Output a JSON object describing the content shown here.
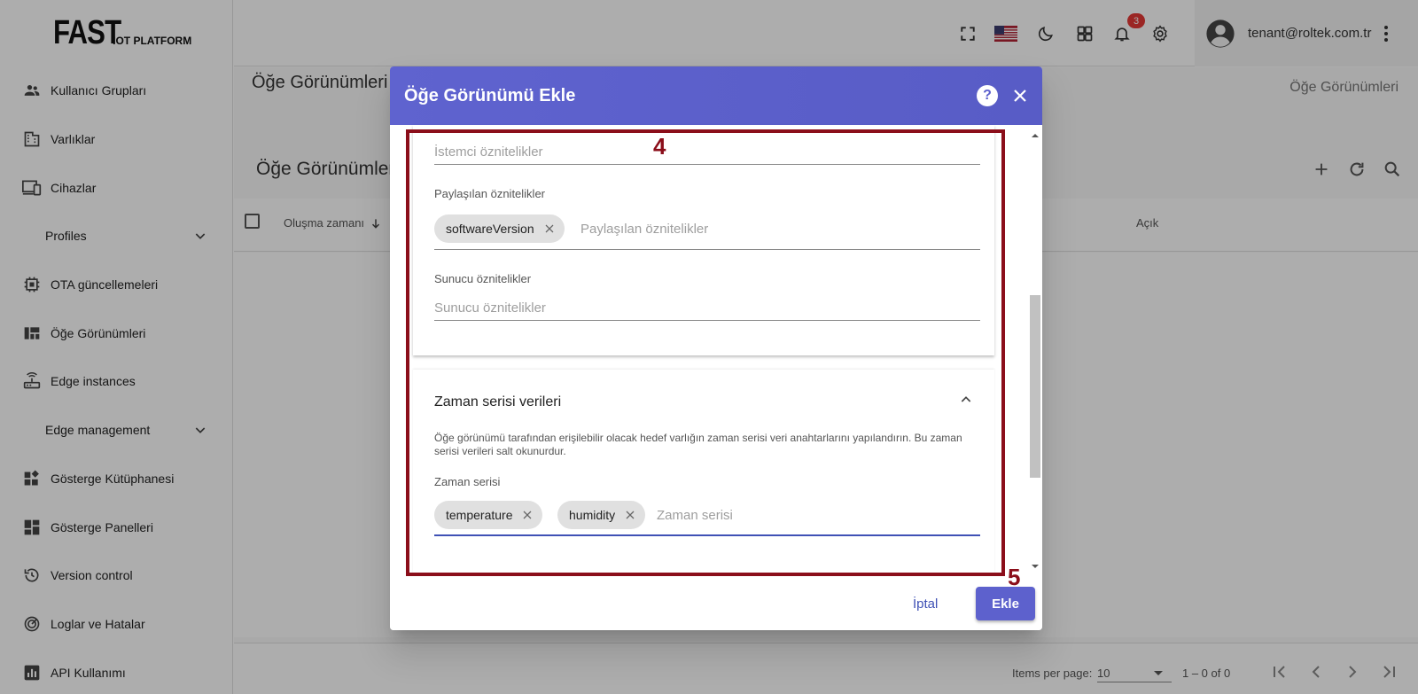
{
  "logo": {
    "main": "FAST",
    "sub": "IOT PLATFORM"
  },
  "sidebar": {
    "items": [
      {
        "label": "Kullanıcı Grupları",
        "icon": "users-icon"
      },
      {
        "label": "Varlıklar",
        "icon": "building-icon"
      },
      {
        "label": "Cihazlar",
        "icon": "devices-icon"
      },
      {
        "label": "Profiles",
        "icon": "",
        "section": true
      },
      {
        "label": "OTA güncellemeleri",
        "icon": "chip-icon"
      },
      {
        "label": "Öğe Görünümleri",
        "icon": "view-quilt-icon"
      },
      {
        "label": "Edge instances",
        "icon": "router-icon"
      },
      {
        "label": "Edge management",
        "icon": "",
        "section": true
      },
      {
        "label": "Gösterge Kütüphanesi",
        "icon": "widgets-icon"
      },
      {
        "label": "Gösterge Panelleri",
        "icon": "dashboard-icon"
      },
      {
        "label": "Version control",
        "icon": "history-icon"
      },
      {
        "label": "Loglar ve Hatalar",
        "icon": "track-changes-icon"
      },
      {
        "label": "API Kullanımı",
        "icon": "bar-chart-icon"
      }
    ]
  },
  "header": {
    "notification_count": "3",
    "user_email": "tenant@roltek.com.tr"
  },
  "main": {
    "page_title": "Öğe Görünümleri",
    "breadcrumb": "Öğe Görünümleri",
    "card_title": "Öğe Görünümleri",
    "columns": {
      "created": "Oluşma zamanı",
      "public": "Açık"
    },
    "pager": {
      "items_per_page_label": "Items per page:",
      "items_per_page_value": "10",
      "range": "1 – 0 of 0"
    }
  },
  "dialog": {
    "title": "Öğe Görünümü Ekle",
    "client_attrs": {
      "placeholder": "İstemci öznitelikler"
    },
    "shared_attrs": {
      "label": "Paylaşılan öznitelikler",
      "chip": "softwareVersion",
      "placeholder": "Paylaşılan öznitelikler"
    },
    "server_attrs": {
      "label": "Sunucu öznitelikler",
      "placeholder": "Sunucu öznitelikler"
    },
    "timeseries": {
      "title": "Zaman serisi verileri",
      "description": "Öğe görünümü tarafından erişilebilir olacak hedef varlığın zaman serisi veri anahtarlarını yapılandırın. Bu zaman serisi verileri salt okunurdur.",
      "label": "Zaman serisi",
      "chips": [
        "temperature",
        "humidity"
      ],
      "placeholder": "Zaman serisi"
    },
    "cancel_label": "İptal",
    "add_label": "Ekle"
  },
  "annotations": {
    "step4": "4",
    "step5": "5"
  },
  "colors": {
    "primary": "#5d61cd",
    "annotation": "#8b0e1a",
    "badge": "#e53935"
  }
}
